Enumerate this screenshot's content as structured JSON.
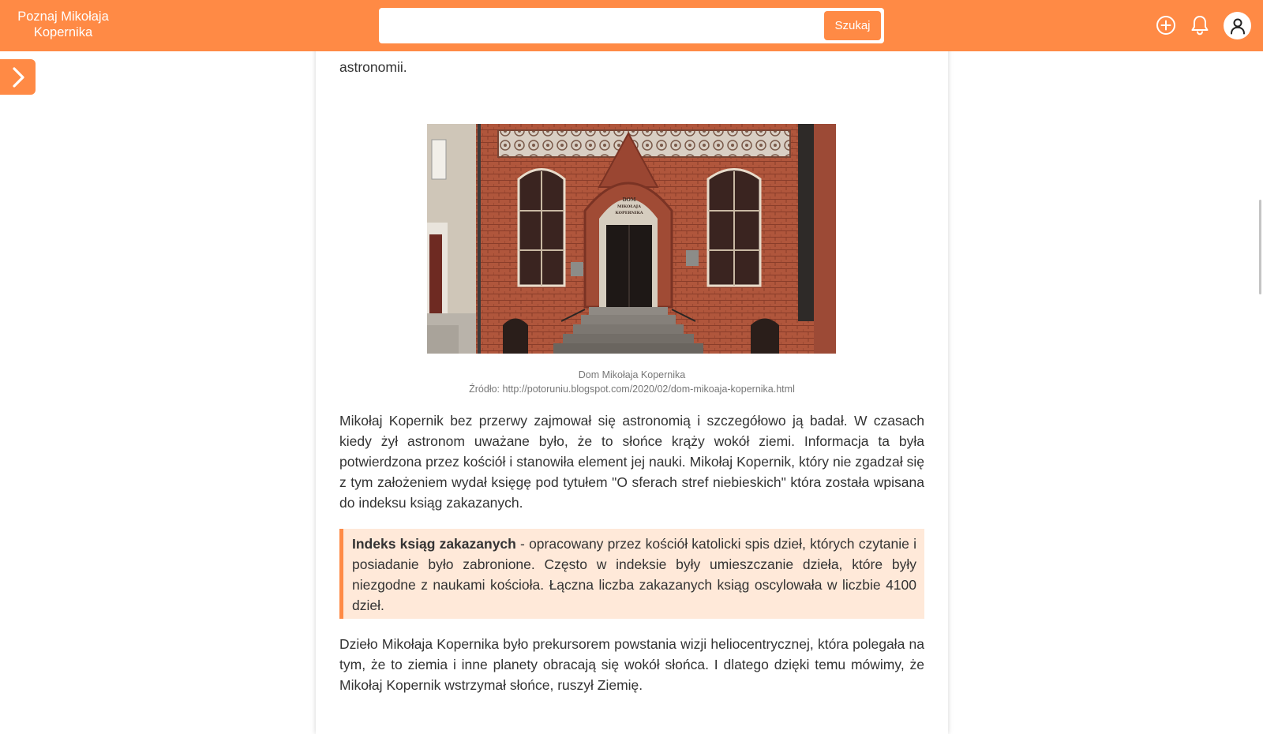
{
  "header": {
    "brand_line1": "Poznaj Mikołaja",
    "brand_line2": "Kopernika",
    "search_value": "",
    "search_placeholder": "",
    "search_button": "Szukaj",
    "icons": [
      "add-circle-icon",
      "bell-icon",
      "user-icon"
    ]
  },
  "sidebar": {
    "toggle_icon": "chevron-right-icon"
  },
  "article": {
    "top_paragraph_tail": "astronomii.",
    "figure": {
      "alt": "Dom Mikołaja Kopernika",
      "door_sign": [
        "DOM",
        "MIKOŁAJA",
        "KOPERNIKA"
      ],
      "caption": "Dom Mikołaja Kopernika",
      "source": "Źródło: http://potoruniu.blogspot.com/2020/02/dom-mikoaja-kopernika.html"
    },
    "paragraph1": "Mikołaj Kopernik bez przerwy zajmował się astronomią i szczegółowo ją badał. W czasach kiedy żył astronom uważane było, że  to słońce krąży wokół ziemi. Informacja ta była potwierdzona przez kościół i stanowiła element jej nauki.  Mikołaj Kopernik, który nie zgadzał się z tym założeniem wydał księgę pod tytułem \"O sferach stref niebieskich\" która została wpisana do indeksu ksiąg zakazanych.",
    "callout": {
      "term": "Indeks ksiąg zakazanych",
      "definition": " - opracowany przez kościół katolicki spis dzieł, których czytanie i posiadanie było zabronione. Często w indeksie były umieszczanie dzieła, które były niezgodne z naukami kościoła. Łączna liczba zakazanych ksiąg oscylowała w liczbie 4100 dzieł."
    },
    "paragraph2": "Dzieło Mikołaja Kopernika było prekursorem powstania wizji heliocentrycznej, która polegała na tym, że to ziemia i inne planety obracają się wokół słońca. I dlatego dzięki temu mówimy, że Mikołaj Kopernik wstrzymał słońce, ruszył Ziemię."
  },
  "colors": {
    "accent": "#ff8a45",
    "callout_bg": "#ffe9d9",
    "text": "#333333",
    "caption": "#777777"
  }
}
